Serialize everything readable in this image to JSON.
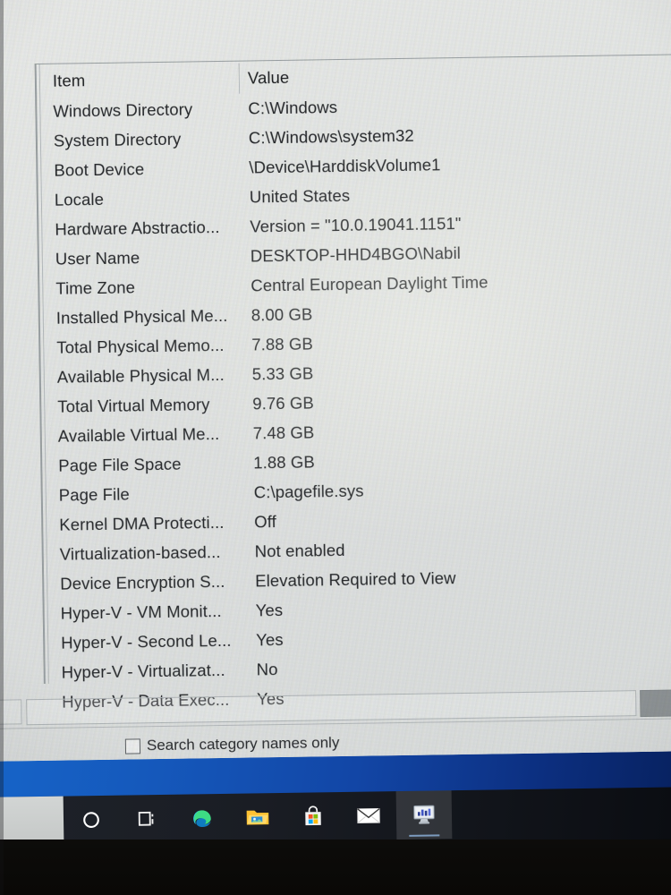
{
  "app": {
    "name": "System Information",
    "icon": "system-information-icon"
  },
  "table": {
    "columns": [
      "Item",
      "Value"
    ],
    "rows": [
      {
        "item": "Windows Directory",
        "value": "C:\\Windows"
      },
      {
        "item": "System Directory",
        "value": "C:\\Windows\\system32"
      },
      {
        "item": "Boot Device",
        "value": "\\Device\\HarddiskVolume1"
      },
      {
        "item": "Locale",
        "value": "United States"
      },
      {
        "item": "Hardware Abstractio...",
        "value": "Version = \"10.0.19041.1151\""
      },
      {
        "item": "User Name",
        "value": "DESKTOP-HHD4BGO\\Nabil"
      },
      {
        "item": "Time Zone",
        "value": "Central European Daylight Time"
      },
      {
        "item": "Installed Physical Me...",
        "value": "8.00 GB"
      },
      {
        "item": "Total Physical Memo...",
        "value": "7.88 GB"
      },
      {
        "item": "Available Physical M...",
        "value": "5.33 GB"
      },
      {
        "item": "Total Virtual Memory",
        "value": "9.76 GB"
      },
      {
        "item": "Available Virtual Me...",
        "value": "7.48 GB"
      },
      {
        "item": "Page File Space",
        "value": "1.88 GB"
      },
      {
        "item": "Page File",
        "value": "C:\\pagefile.sys"
      },
      {
        "item": "Kernel DMA Protecti...",
        "value": "Off"
      },
      {
        "item": "Virtualization-based...",
        "value": "Not enabled"
      },
      {
        "item": "Device Encryption S...",
        "value": "Elevation Required to View"
      },
      {
        "item": "Hyper-V - VM Monit...",
        "value": "Yes"
      },
      {
        "item": "Hyper-V - Second Le...",
        "value": "Yes"
      },
      {
        "item": "Hyper-V - Virtualizat...",
        "value": "No"
      },
      {
        "item": "Hyper-V - Data Exec...",
        "value": "Yes"
      }
    ]
  },
  "search": {
    "value": "",
    "placeholder": "",
    "button_label": "",
    "category_only_label": "Search category names only",
    "category_only_checked": false
  },
  "taskbar": {
    "items": [
      {
        "name": "cortana-icon",
        "label": "Cortana",
        "active": false
      },
      {
        "name": "task-view-icon",
        "label": "Task View",
        "active": false
      },
      {
        "name": "microsoft-edge-icon",
        "label": "Microsoft Edge",
        "active": false
      },
      {
        "name": "file-explorer-icon",
        "label": "File Explorer",
        "active": false
      },
      {
        "name": "microsoft-store-icon",
        "label": "Microsoft Store",
        "active": false
      },
      {
        "name": "mail-icon",
        "label": "Mail",
        "active": false
      },
      {
        "name": "system-information-icon",
        "label": "System Information",
        "active": true
      }
    ]
  },
  "colors": {
    "window_background": "#e4e6e4",
    "text": "#26282b",
    "taskbar": "#12151b",
    "wallpaper_blue": "#1246a6",
    "accent": "#0a6cc9"
  }
}
